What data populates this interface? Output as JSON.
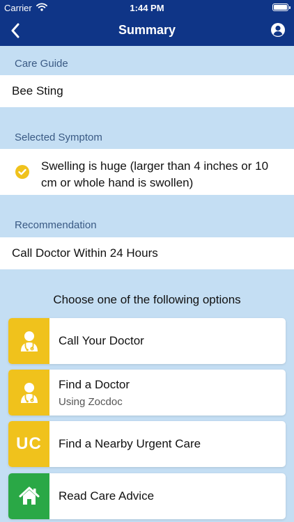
{
  "status_bar": {
    "carrier": "Carrier",
    "time": "1:44 PM"
  },
  "nav": {
    "title": "Summary"
  },
  "care_guide": {
    "label": "Care Guide",
    "value": "Bee Sting"
  },
  "selected_symptom": {
    "label": "Selected Symptom",
    "value": "Swelling is huge (larger than 4 inches or 10 cm or whole hand is swollen)"
  },
  "recommendation": {
    "label": "Recommendation",
    "value": "Call Doctor Within 24 Hours"
  },
  "options": {
    "heading": "Choose one of the following options",
    "items": [
      {
        "label": "Call Your Doctor",
        "icon": "doctor-icon",
        "color": "#f0c21c"
      },
      {
        "label": "Find a Doctor",
        "sublabel": "Using Zocdoc",
        "icon": "doctor-icon",
        "color": "#f0c21c"
      },
      {
        "label": "Find a Nearby Urgent Care",
        "icon_text": "UC",
        "color": "#f0c21c"
      },
      {
        "label": "Read Care Advice",
        "icon": "home-icon",
        "color": "#2aa846"
      }
    ]
  },
  "colors": {
    "nav_bg": "#0f3587",
    "page_bg": "#c4def3",
    "check": "#f0c21c"
  }
}
